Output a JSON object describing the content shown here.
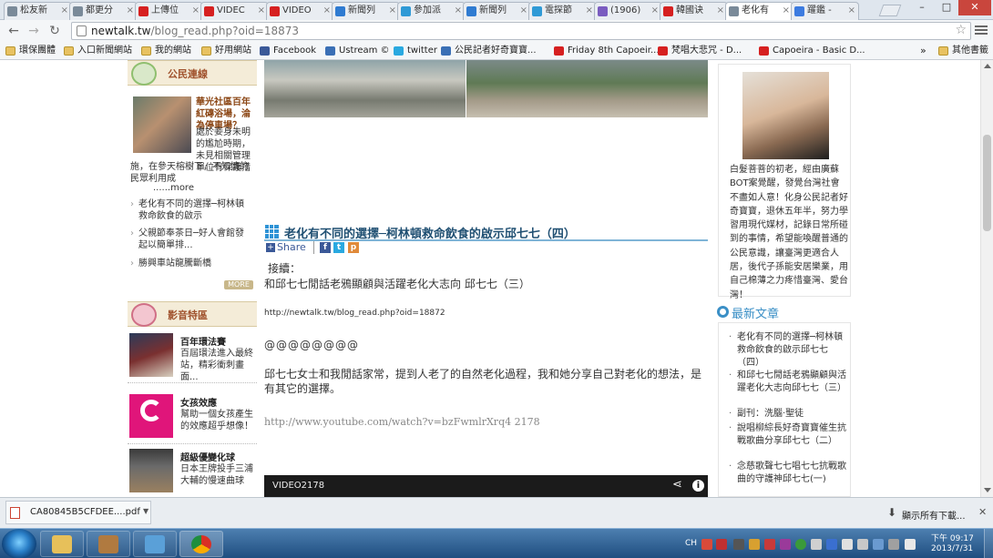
{
  "browser": {
    "tabs": [
      {
        "label": "松友新",
        "color": "#7a8a99"
      },
      {
        "label": "都更分",
        "color": "#7a8a99"
      },
      {
        "label": "上傳位",
        "color": "#d62020"
      },
      {
        "label": "VIDEC",
        "color": "#d62020"
      },
      {
        "label": "VIDEO",
        "color": "#d62020"
      },
      {
        "label": "新聞列",
        "color": "#2f7bd1"
      },
      {
        "label": "參加派",
        "color": "#2f9ad6"
      },
      {
        "label": "新聞列",
        "color": "#2f7bd1"
      },
      {
        "label": "電探節",
        "color": "#2f9ad6"
      },
      {
        "label": "(1906)",
        "color": "#7a5cc0"
      },
      {
        "label": "韓國诀",
        "color": "#d62020"
      },
      {
        "label": "老化有",
        "color": "#7a8a99",
        "active": true
      },
      {
        "label": "躍鑑 -",
        "color": "#3c7be0"
      }
    ],
    "window_controls": {
      "minimize": "–",
      "maximize": "□",
      "close": "✕"
    },
    "url_host": "newtalk.tw",
    "url_path": "/blog_read.php?oid=18873",
    "nav": {
      "back": "←",
      "forward": "→",
      "reload": "↻"
    },
    "star": "☆",
    "bookmarks": [
      {
        "label": "環保團體",
        "icon": "folder-icon",
        "color": "#e8c261"
      },
      {
        "label": "入口新聞網站",
        "icon": "folder-icon",
        "color": "#e8c261"
      },
      {
        "label": "我的網站",
        "icon": "folder-icon",
        "color": "#e8c261"
      },
      {
        "label": "好用網站",
        "icon": "folder-icon",
        "color": "#e8c261"
      },
      {
        "label": "Facebook",
        "icon": "facebook-icon",
        "color": "#3b5998"
      },
      {
        "label": "Ustream ©",
        "icon": "ustream-icon",
        "color": "#3a6fb5"
      },
      {
        "label": "twitter",
        "icon": "twitter-icon",
        "color": "#2aa9e0"
      },
      {
        "label": "公民記者好奇寶寶...",
        "icon": "ustream-icon",
        "color": "#3a6fb5"
      },
      {
        "label": "Friday 8th Capoeir...",
        "icon": "youtube-icon",
        "color": "#d62020"
      },
      {
        "label": "梵唱大悲咒 - D...",
        "icon": "youtube-icon",
        "color": "#d62020"
      },
      {
        "label": "Capoeira - Basic D...",
        "icon": "youtube-icon",
        "color": "#d62020"
      }
    ],
    "bookmarks_overflow": "»",
    "other_bookmarks": "其他書籤"
  },
  "left": {
    "citizen_title": "公民連線",
    "feature_title": "華光社區百年紅磚浴場，淪為停車場？",
    "feature_desc": "處於妾身未明的尷尬時期，未見相關管理單位有保護措施，在參天榕樹下，不知情的民眾利用成",
    "feature_more": "......more",
    "links": [
      "老化有不同的選擇─柯林頓救命飲食的啟示",
      "父親節奉茶日─好人會館發起以簡單排...",
      "勝興車站龍騰斷橋"
    ],
    "more_button": "MORE",
    "video_title": "影音特區",
    "videos": [
      {
        "title": "百年環法賽",
        "desc": "百屆環法進入最終站，精彩衝刺畫面..."
      },
      {
        "title": "女孩效應",
        "desc": "幫助一個女孩產生的效應超乎想像！"
      },
      {
        "title": "超級優變化球",
        "desc": "日本王牌投手三浦大輔的慢速曲球"
      }
    ]
  },
  "article": {
    "title": "老化有不同的選擇─柯林頓救命飲食的啟示邱七七（四）",
    "share": "Share",
    "continued": "接續：",
    "prev_title": "和邱七七閒話老鴉顯顧與活躍老化大志向 邱七七（三）",
    "link": "http://newtalk.tw/blog_read.php?oid=18872",
    "ats": "@@@@@@@@",
    "paragraph": "邱七七女士和我閒話家常，提到人老了的自然老化過程，我和她分享自己對老化的想法，是有其它的選擇。",
    "youtube_link": "http://www.youtube.com/watch?v=bzFwmlrXrq4 2178",
    "video_label": "VIDEO2178"
  },
  "right": {
    "bio": "白髮菩菩的初老，經由廣蘇BOT案覺醒，發覺台灣社會不盡如人意！化身公民記者好奇寶寶，退休五年半，努力學習用現代媒材，記錄日常所碰到的事情，希望能喚醒普通的公民意識，讓臺灣更適合人居，後代子孫能安居樂業，用自己棉薄之力疼惜臺灣、愛台灣！",
    "new_articles_title": "最新文章",
    "new_articles": [
      "老化有不同的選擇─柯林頓救命飲食的啟示邱七七（四）",
      "和邱七七閒話老鴉顯顧與活躍老化大志向邱七七（三）",
      "副刊：洗腦·聖徒",
      "說唱柳綜長好奇寶寶催生抗戰歌曲分享邱七七（二）",
      "念慈歌聲七七唱七七抗戰歌曲的守護神邱七七(一)"
    ]
  },
  "download": {
    "file": "CA80845B5CFDEE....pdf",
    "show_all": "顯示所有下載...",
    "close": "✕"
  },
  "taskbar": {
    "lang": "CH",
    "time": "下午 09:17",
    "date": "2013/7/31"
  }
}
